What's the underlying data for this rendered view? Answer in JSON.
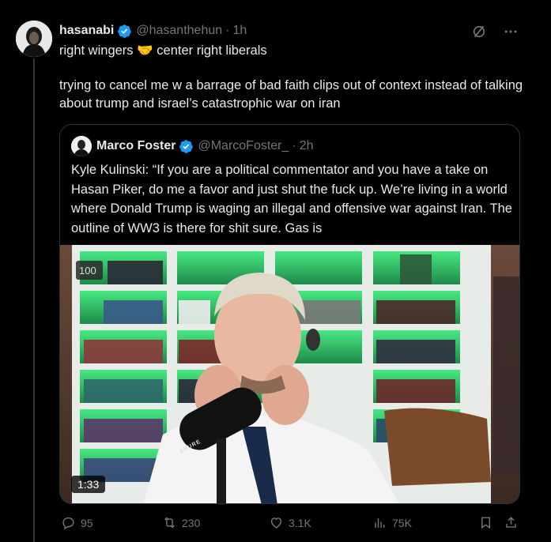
{
  "post": {
    "display_name": "hasanabi",
    "handle": "@hasanthehun",
    "separator": "·",
    "time": "1h",
    "line1_before": "right wingers",
    "line1_emoji": "🤝",
    "line1_after": "center right liberals",
    "paragraph2": "trying to cancel me w a barrage of bad faith clips out of context instead of talking about trump and israel’s catastrophic war on iran"
  },
  "quote": {
    "display_name": "Marco Foster",
    "handle": "@MarcoFoster_",
    "separator": "·",
    "time": "2h",
    "text": "Kyle Kulinski: “If you are a political commentator and you have a take on Hasan Piker, do me a favor and just shut the fuck up. We’re living in a world where Donald Trump is waging an illegal and offensive war against Iran. The outline of WW3 is there for shit sure. Gas is",
    "video_duration": "1:33",
    "mic_brand": "SHURE",
    "overlay_badge": "100"
  },
  "actions": {
    "replies": "95",
    "reposts": "230",
    "likes": "3.1K",
    "views": "75K"
  },
  "icons": {
    "verified": "verified-badge-icon",
    "grok": "grok-slash-icon",
    "more": "more-dots-icon",
    "reply": "reply-icon",
    "repost": "repost-icon",
    "like": "heart-icon",
    "views": "views-bar-icon",
    "bookmark": "bookmark-icon",
    "share": "share-icon"
  },
  "colors": {
    "background": "#000000",
    "text_primary": "#e7e9ea",
    "text_secondary": "#71767b",
    "verified_blue": "#1d9bf0",
    "border": "#2f3336",
    "shelf_glow": "#3fe07a"
  }
}
